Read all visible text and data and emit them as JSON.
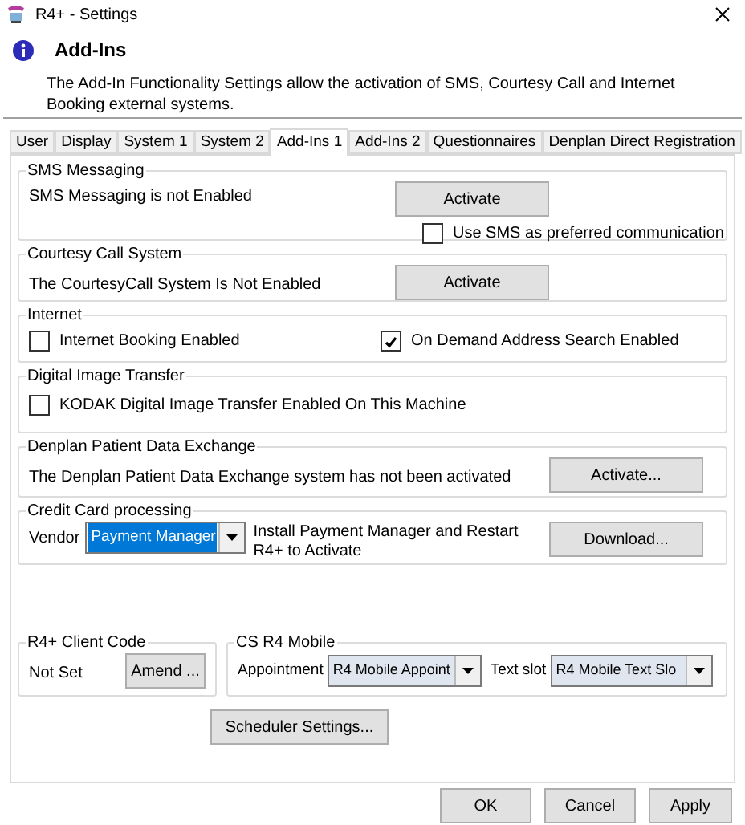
{
  "window": {
    "title": "R4+ - Settings"
  },
  "header": {
    "title": "Add-Ins",
    "description": "The Add-In Functionality Settings allow the activation of SMS, Courtesy Call and Internet Booking external systems."
  },
  "tabs": [
    {
      "label": "User",
      "selected": false
    },
    {
      "label": "Display",
      "selected": false
    },
    {
      "label": "System 1",
      "selected": false
    },
    {
      "label": "System 2",
      "selected": false
    },
    {
      "label": "Add-Ins 1",
      "selected": true
    },
    {
      "label": "Add-Ins 2",
      "selected": false
    },
    {
      "label": "Questionnaires",
      "selected": false
    },
    {
      "label": "Denplan Direct Registration",
      "selected": false
    }
  ],
  "sms_messaging": {
    "title": "SMS Messaging",
    "status": "SMS Messaging is not Enabled",
    "button": "Activate",
    "preferred": {
      "label": "Use SMS as preferred communication",
      "checked": false
    }
  },
  "courtesy_call": {
    "title": "Courtesy Call System",
    "status": "The CourtesyCall System Is Not Enabled",
    "button": "Activate"
  },
  "internet": {
    "title": "Internet",
    "options": [
      {
        "label": "Internet Booking Enabled",
        "checked": false
      },
      {
        "label": "On Demand Address Search Enabled",
        "checked": true
      }
    ]
  },
  "digital_image_transfer": {
    "title": "Digital Image Transfer",
    "options": [
      {
        "label": "KODAK Digital Image Transfer Enabled On This Machine",
        "checked": false
      }
    ]
  },
  "denplan": {
    "title": "Denplan Patient Data Exchange",
    "status": "The Denplan Patient Data Exchange system has not been activated",
    "button": "Activate..."
  },
  "credit_card": {
    "title": "Credit Card processing",
    "vendor_label": "Vendor",
    "vendor": "Payment Manager",
    "note": "Install Payment Manager and Restart R4+ to Activate",
    "button": "Download..."
  },
  "client_code": {
    "title": "R4+ Client Code",
    "value": "Not Set",
    "button": "Amend ..."
  },
  "cs_r4_mobile": {
    "title": "CS R4 Mobile",
    "appointment_label": "Appointment",
    "appointment": "R4 Mobile Appoint",
    "text_slot_label": "Text slot",
    "text_slot": "R4 Mobile Text Slo"
  },
  "scheduler_button": "Scheduler Settings...",
  "buttons": [
    "OK",
    "Cancel",
    "Apply"
  ]
}
